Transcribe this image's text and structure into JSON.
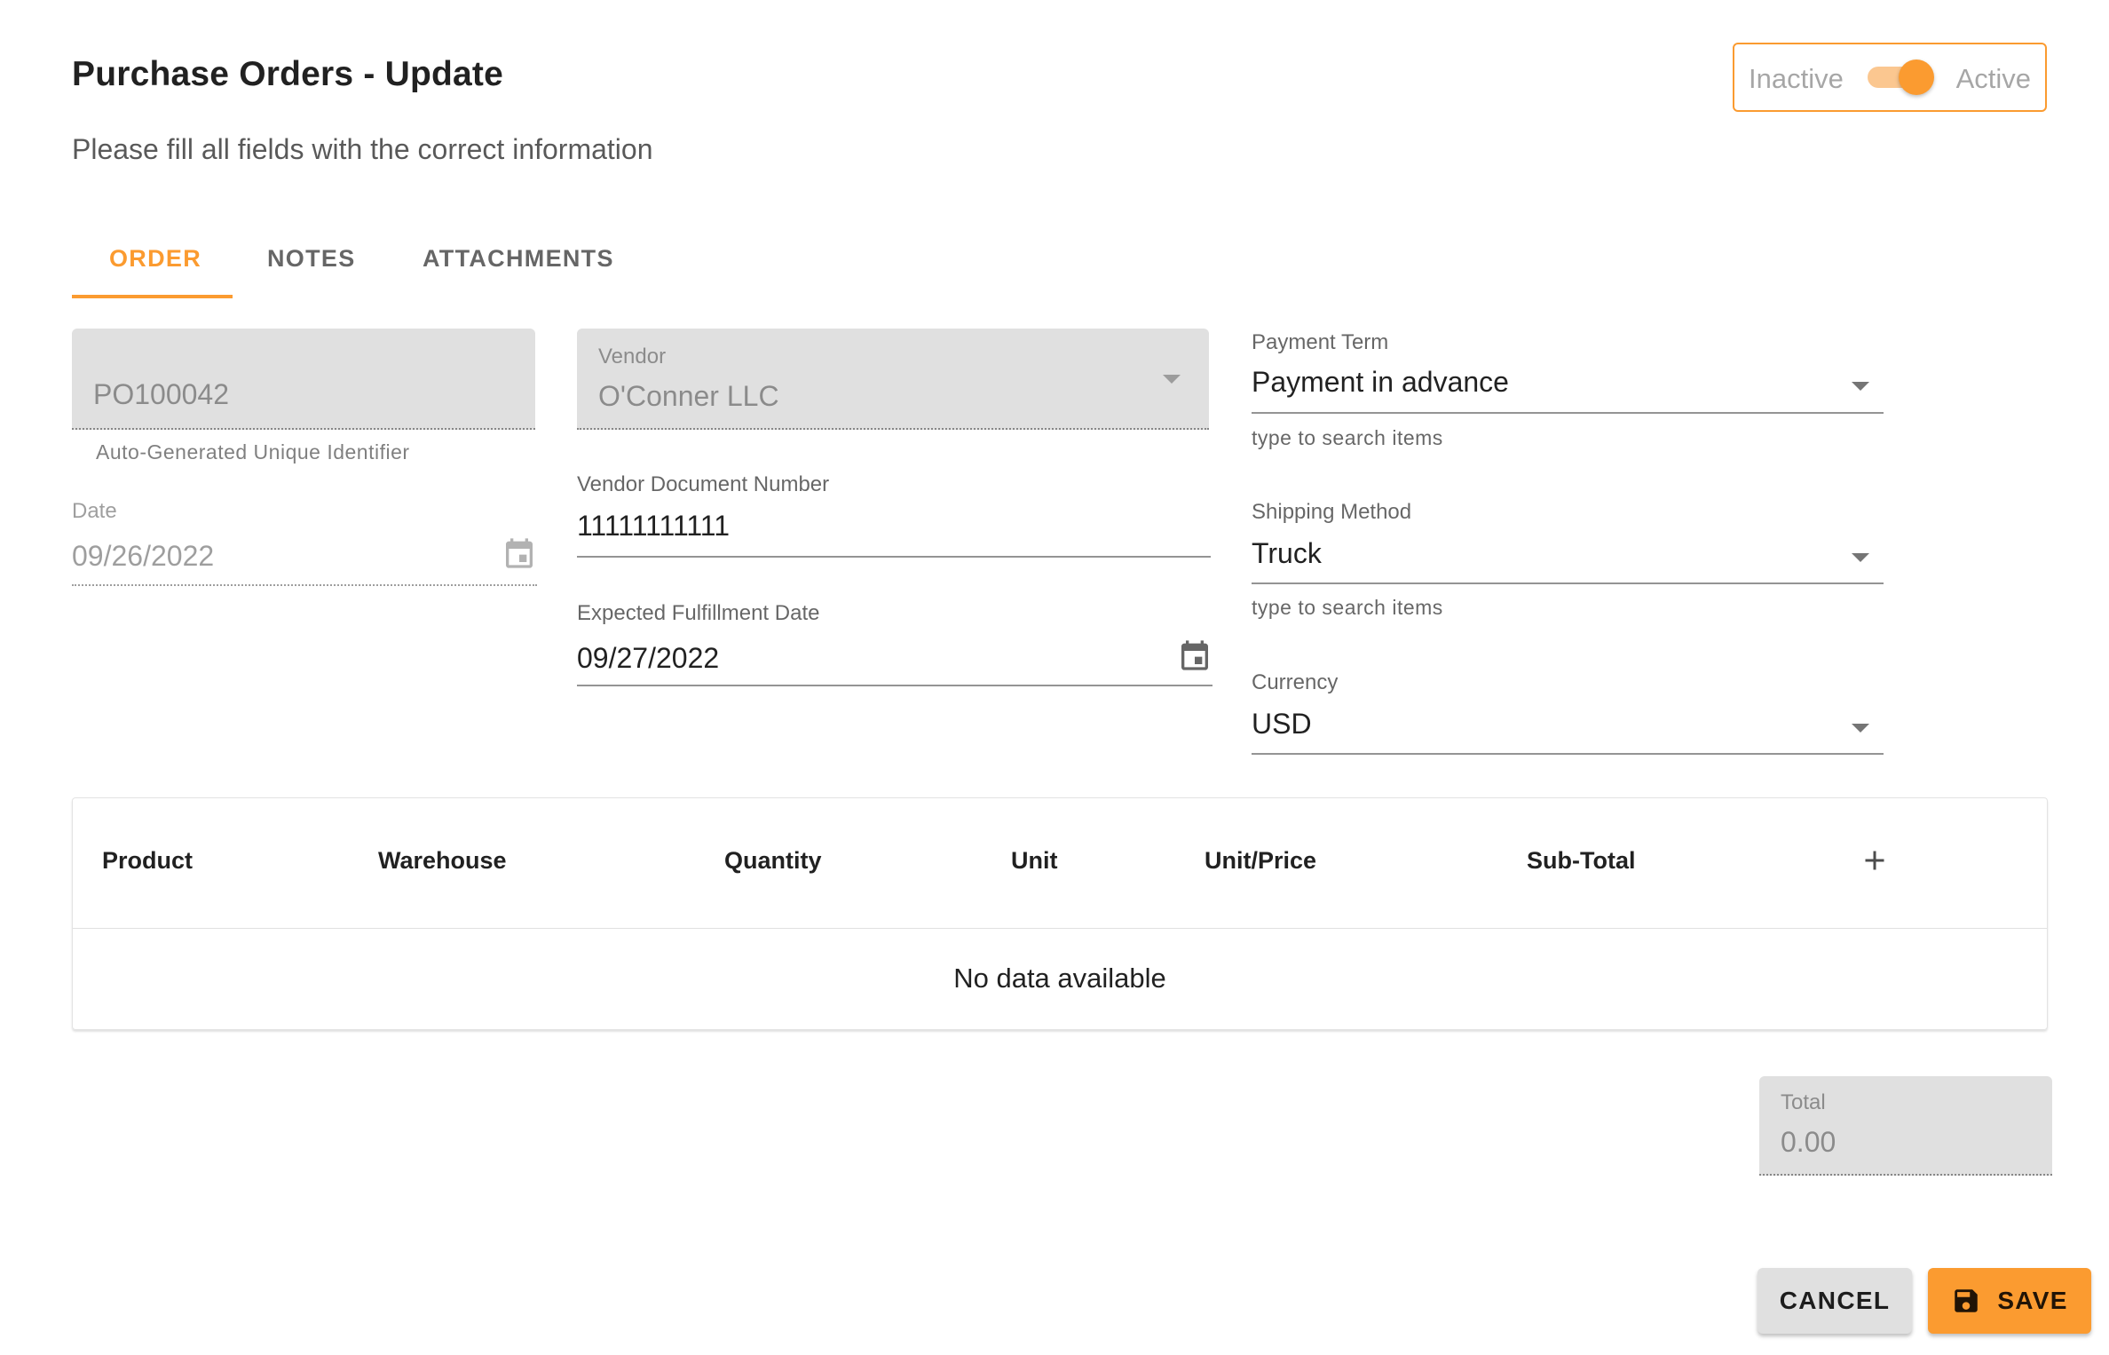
{
  "header": {
    "title": "Purchase Orders - Update",
    "subtitle": "Please fill all fields with the correct information"
  },
  "status_toggle": {
    "off_label": "Inactive",
    "on_label": "Active",
    "value": "Active"
  },
  "tabs": [
    {
      "label": "ORDER",
      "active": true
    },
    {
      "label": "NOTES",
      "active": false
    },
    {
      "label": "ATTACHMENTS",
      "active": false
    }
  ],
  "form": {
    "po_number": {
      "value": "PO100042",
      "hint": "Auto-Generated Unique Identifier"
    },
    "date": {
      "label": "Date",
      "value": "09/26/2022"
    },
    "vendor": {
      "label": "Vendor",
      "value": "O'Conner LLC"
    },
    "vendor_document_number": {
      "label": "Vendor Document Number",
      "value": "11111111111"
    },
    "expected_fulfillment_date": {
      "label": "Expected Fulfillment Date",
      "value": "09/27/2022"
    },
    "payment_term": {
      "label": "Payment Term",
      "value": "Payment in advance",
      "hint": "type to search items"
    },
    "shipping_method": {
      "label": "Shipping Method",
      "value": "Truck",
      "hint": "type to search items"
    },
    "currency": {
      "label": "Currency",
      "value": "USD"
    }
  },
  "table": {
    "columns": [
      "Product",
      "Warehouse",
      "Quantity",
      "Unit",
      "Unit/Price",
      "Sub-Total"
    ],
    "empty_text": "No data available"
  },
  "total": {
    "label": "Total",
    "value": "0.00"
  },
  "actions": {
    "cancel_label": "CANCEL",
    "save_label": "SAVE"
  },
  "colors": {
    "accent": "#fb9b30",
    "disabled_fill": "#e0e0e0"
  },
  "icons": [
    "calendar-icon",
    "dropdown-caret-icon",
    "add-icon",
    "save-icon"
  ]
}
